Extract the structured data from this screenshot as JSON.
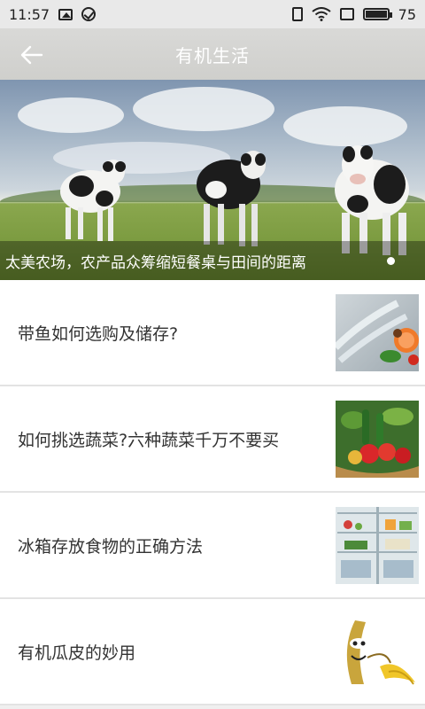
{
  "status_bar": {
    "time": "11:57",
    "battery_level": "75",
    "icons": [
      "image-icon",
      "check-circle-icon",
      "vibrate-icon",
      "wifi-icon",
      "sim-icon",
      "battery-icon"
    ]
  },
  "header": {
    "title": "有机生活",
    "back_icon": "arrow-left-icon"
  },
  "banner": {
    "caption": "太美农场，农产品众筹缩短餐桌与田间的距离",
    "slide_count": 1,
    "active_slide": 1
  },
  "articles": [
    {
      "title": "带鱼如何选购及储存?",
      "thumbnail": "fish-and-vegetables-photo"
    },
    {
      "title": "如何挑选蔬菜?六种蔬菜千万不要买",
      "thumbnail": "vegetable-basket-photo"
    },
    {
      "title": "冰箱存放食物的正确方法",
      "thumbnail": "fridge-photo"
    },
    {
      "title": "有机瓜皮的妙用",
      "thumbnail": "banana-cartoon-photo"
    }
  ],
  "colors": {
    "header_bg": "#d4d4d1",
    "page_bg": "#efefef"
  }
}
